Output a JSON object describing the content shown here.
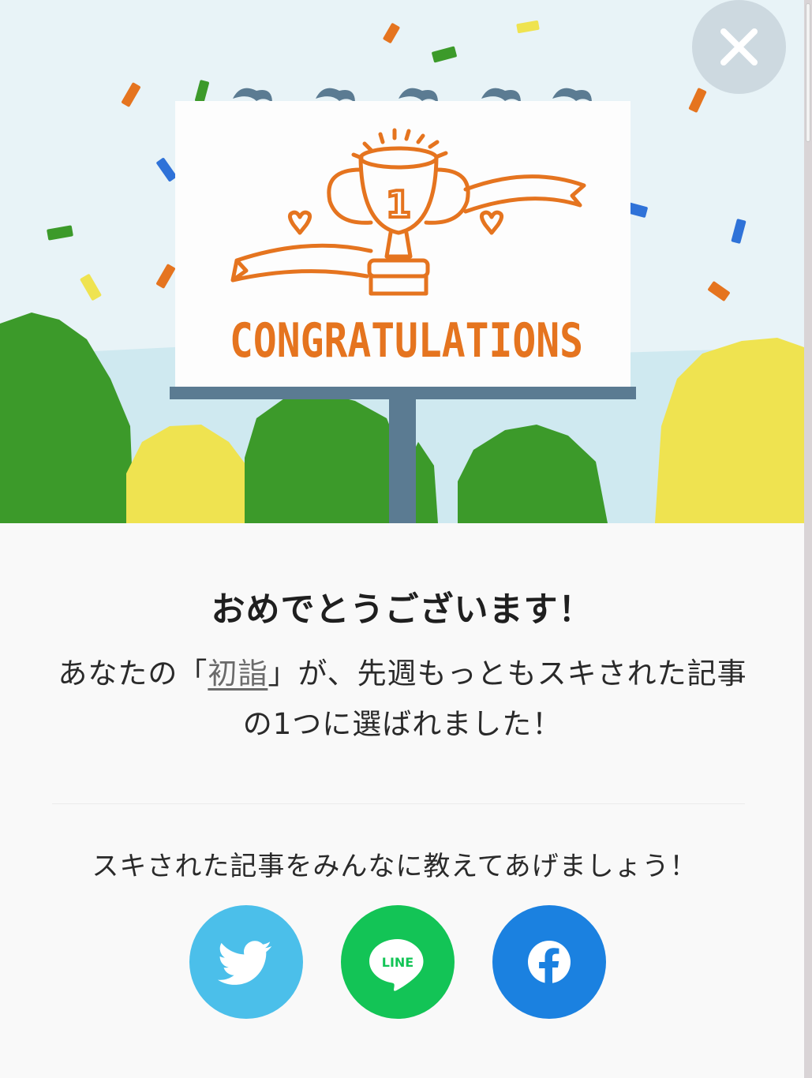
{
  "hero": {
    "billboard_text": "CONGRATULATIONS",
    "trophy_rank": "1"
  },
  "close": {
    "label": "×"
  },
  "title": "おめでとうございます！",
  "message": {
    "prefix": "あなたの「",
    "article_title": "初詣",
    "suffix": "」が、先週もっともスキされた記事の1つに選ばれました！"
  },
  "share": {
    "prompt": "スキされた記事をみんなに教えてあげましょう！",
    "buttons": [
      {
        "name": "twitter",
        "icon": "twitter-bird-icon",
        "color": "#4bbfea"
      },
      {
        "name": "line",
        "icon": "line-logo-icon",
        "label": "LINE",
        "color": "#13c456"
      },
      {
        "name": "facebook",
        "icon": "facebook-f-icon",
        "color": "#1b81e0"
      }
    ]
  },
  "colors": {
    "accent_orange": "#e5741f",
    "sky": "#e6f2f6",
    "tree_green": "#3c9a2a",
    "tree_yellow": "#efe350"
  }
}
